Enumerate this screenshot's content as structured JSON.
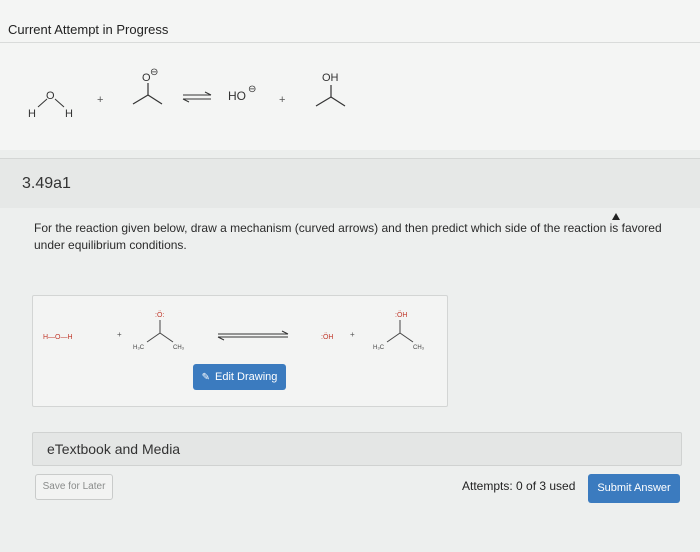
{
  "header": {
    "title": "Current Attempt in Progress"
  },
  "top_reaction": {
    "water": {
      "o": "O",
      "h1": "H",
      "h2": "H"
    },
    "plus": "+",
    "acetone_anion": {
      "o": "O",
      "charge": "⊖"
    },
    "hydroxide": {
      "label": "HO",
      "charge": "⊖"
    },
    "alcohol": {
      "oh": "OH"
    }
  },
  "question": {
    "number": "3.49a1",
    "prompt": "For the reaction given below, draw a mechanism (curved arrows) and then predict which side of the reaction is favored under equilibrium conditions."
  },
  "drawing": {
    "water": "H—O—H",
    "plus": "+",
    "alkoxide_o": ":Ö:",
    "h3c": "H₃C",
    "ch3": "CH₃",
    "hydroxide": ":ÖH",
    "product_oh": ":ÖH",
    "edit_label": "Edit Drawing"
  },
  "etextbook": {
    "label": "eTextbook and Media"
  },
  "footer": {
    "save_label": "Save for Later",
    "attempts": "Attempts: 0 of 3 used",
    "submit_label": "Submit Answer"
  }
}
